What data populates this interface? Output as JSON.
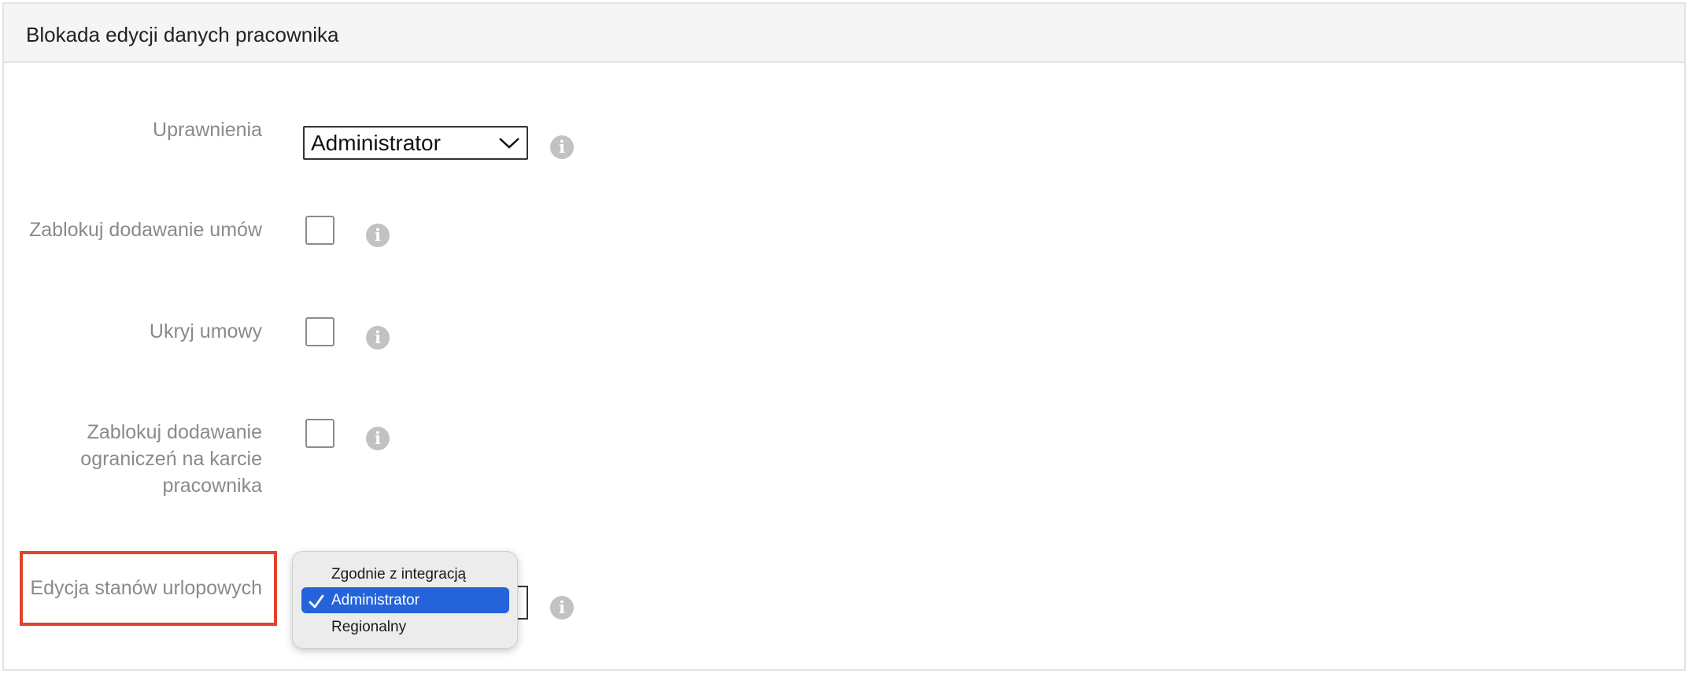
{
  "panel": {
    "title": "Blokada edycji danych pracownika"
  },
  "fields": {
    "permissions": {
      "label": "Uprawnienia",
      "value": "Administrator"
    },
    "block_contracts": {
      "label": "Zablokuj dodawanie umów",
      "checked": false
    },
    "hide_contracts": {
      "label": "Ukryj umowy",
      "checked": false
    },
    "block_restrictions": {
      "label_lines": [
        "Zablokuj dodawanie",
        "ograniczeń na karcie",
        "pracownika"
      ],
      "checked": false
    },
    "leave_edit": {
      "label": "Edycja stanów urlopowych",
      "value": "Administrator"
    }
  },
  "dropdown": {
    "options": [
      "Zgodnie z integracją",
      "Administrator",
      "Regionalny"
    ],
    "selected_index": 1
  },
  "icons": {
    "info": "info-icon",
    "chevron": "chevron-down-icon",
    "check": "checkmark-icon"
  },
  "colors": {
    "highlight": "#e0442c",
    "selection": "#2463d9",
    "info": "#c2c2c2"
  }
}
